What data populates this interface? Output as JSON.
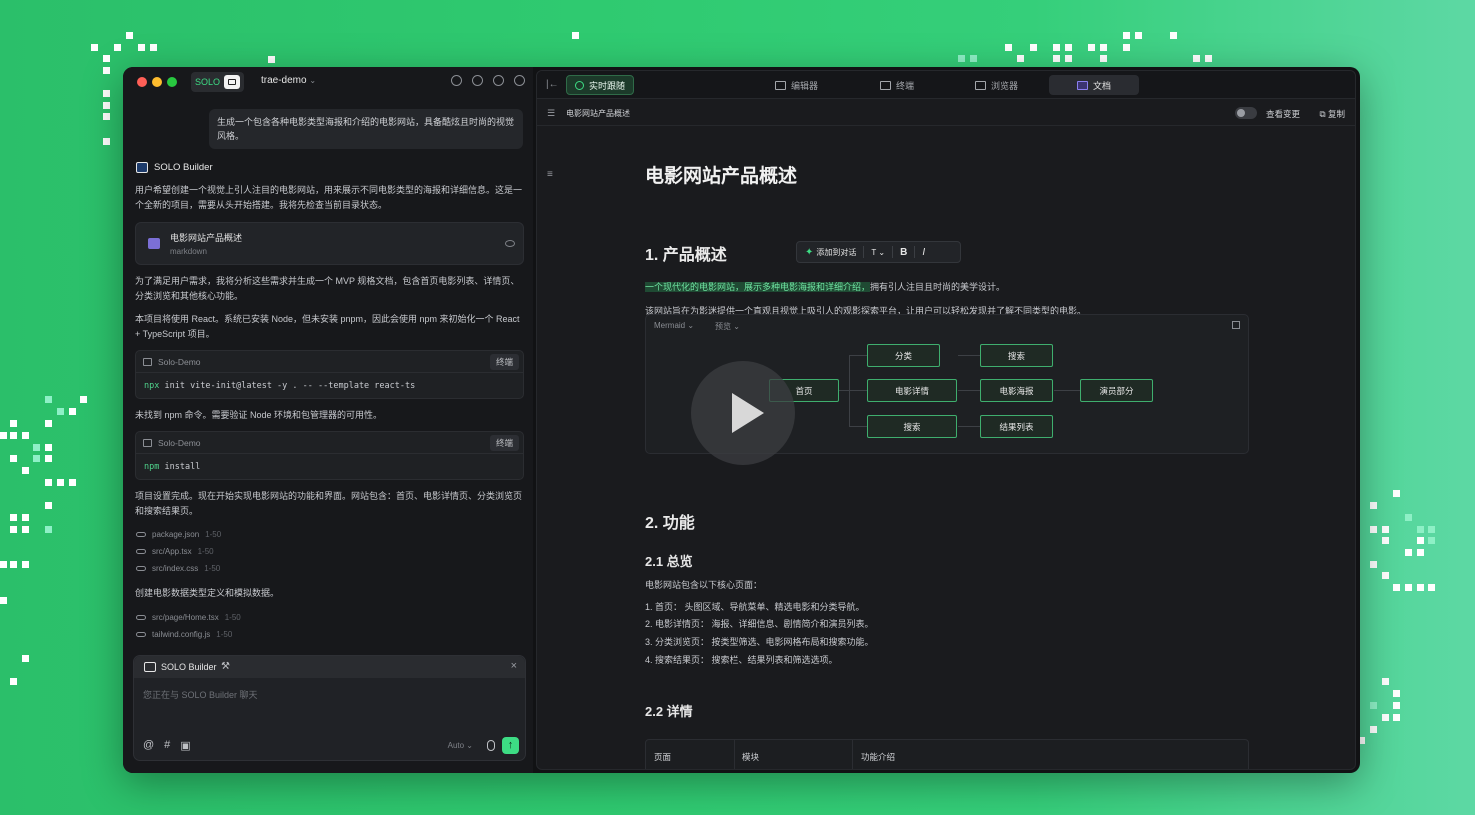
{
  "theme": {
    "accent": "#3ddc84",
    "bg_gradient": [
      "#2bbf6a",
      "#5dd8a4"
    ]
  },
  "left": {
    "solo_label": "SOLO",
    "project": "trae-demo",
    "user_message": "生成一个包含各种电影类型海报和介绍的电影网站，具备酷炫且时尚的视觉风格。",
    "builder_name": "SOLO Builder",
    "intro": "用户希望创建一个视觉上引人注目的电影网站，用来展示不同电影类型的海报和详细信息。这是一个全新的项目，需要从头开始搭建。我将先检查当前目录状态。",
    "doc_card": {
      "title": "电影网站产品概述",
      "subtitle": "markdown"
    },
    "para2": "为了满足用户需求，我将分析这些需求并生成一个 MVP 规格文档，包含首页电影列表、详情页、分类浏览和其他核心功能。",
    "para3": "本项目将使用 React。系统已安装 Node，但未安装 pnpm，因此会使用 npm 来初始化一个 React + TypeScript 项目。",
    "term1": {
      "name": "Solo-Demo",
      "button": "终端",
      "cmd_prefix": "npx",
      "cmd_rest": " init vite-init@latest -y . -- --template react-ts"
    },
    "para4": "未找到 npm 命令。需要验证 Node 环境和包管理器的可用性。",
    "term2": {
      "name": "Solo-Demo",
      "button": "终端",
      "cmd_prefix": "npm",
      "cmd_rest": " install"
    },
    "para5": "项目设置完成。现在开始实现电影网站的功能和界面。网站包含：首页、电影详情页、分类浏览页和搜索结果页。",
    "files1": [
      {
        "name": "package.json",
        "lines": "1-50"
      },
      {
        "name": "src/App.tsx",
        "lines": "1-50"
      },
      {
        "name": "src/index.css",
        "lines": "1-50"
      }
    ],
    "para6": "创建电影数据类型定义和模拟数据。",
    "files2": [
      {
        "name": "src/page/Home.tsx",
        "lines": "1-50"
      },
      {
        "name": "tailwind.config.js",
        "lines": "1-50"
      }
    ],
    "chat": {
      "header": "SOLO Builder",
      "placeholder": "您正在与 SOLO Builder 聊天",
      "close": "×",
      "auto": "Auto ⌄",
      "send": "↑"
    }
  },
  "right": {
    "live_button": "实时跟随",
    "tabs": [
      {
        "label": "编辑器"
      },
      {
        "label": "终端"
      },
      {
        "label": "浏览器"
      },
      {
        "label": "文档"
      }
    ],
    "doc_name": "电影网站产品概述",
    "view_changes": "查看变更",
    "copy": "复制",
    "float_toolbar": {
      "add": "添加到对话",
      "text": "T",
      "bold": "B",
      "italic": "I"
    },
    "doc": {
      "h1": "电影网站产品概述",
      "sec1": "1. 产品概述",
      "p1_highlight": "一个现代化的电影网站，展示多种电影海报和详细介绍，",
      "p1_rest": "拥有引人注目且时尚的美学设计。",
      "p2": "该网站旨在为影迷提供一个直观且视觉上吸引人的观影探索平台，让用户可以轻松发现并了解不同类型的电影。",
      "mermaid": {
        "label": "Mermaid ⌄",
        "preview": "预览 ⌄",
        "nodes": {
          "home": "首页",
          "category": "分类",
          "detail": "电影详情",
          "search_left": "搜索",
          "search_right": "搜索",
          "poster": "电影海报",
          "results": "结果列表",
          "cast": "演员部分"
        }
      },
      "sec2": "2. 功能",
      "sec21": "2.1 总览",
      "p3": "电影网站包含以下核心页面：",
      "list": [
        "1. 首页： 头图区域、导航菜单、精选电影和分类导航。",
        "2. 电影详情页： 海报、详细信息、剧情简介和演员列表。",
        "3. 分类浏览页： 按类型筛选、电影网格布局和搜索功能。",
        "4. 搜索结果页： 搜索栏、结果列表和筛选选项。"
      ],
      "sec22": "2.2 详情",
      "table_headers": [
        "页面",
        "模块",
        "功能介绍"
      ]
    }
  }
}
